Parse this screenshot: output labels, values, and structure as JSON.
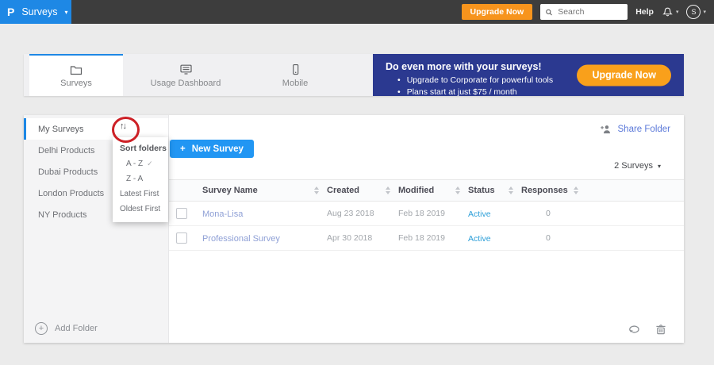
{
  "topbar": {
    "logo_glyph": "P",
    "product_menu_label": "Surveys",
    "upgrade_label": "Upgrade Now",
    "search_placeholder": "Search",
    "help_label": "Help",
    "avatar_initial": "S"
  },
  "tabs": [
    {
      "label": "Surveys",
      "active": true
    },
    {
      "label": "Usage Dashboard",
      "active": false
    },
    {
      "label": "Mobile",
      "active": false
    }
  ],
  "banner": {
    "title": "Do even more with your surveys!",
    "bullets": [
      "Upgrade to Corporate for powerful tools",
      "Plans start at just $75 / month"
    ],
    "cta_label": "Upgrade Now"
  },
  "sidebar": {
    "folders": [
      "My Surveys",
      "Delhi Products",
      "Dubai Products",
      "London Products",
      "NY Products"
    ],
    "active_folder": "My Surveys",
    "add_folder_label": "Add Folder"
  },
  "sort_menu": {
    "title": "Sort folders",
    "options": [
      "A - Z",
      "Z - A",
      "Latest First",
      "Oldest First"
    ],
    "selected_option": "A - Z",
    "check_glyph": "✓"
  },
  "toolbar": {
    "new_survey_label": "New Survey",
    "share_folder_label": "Share Folder",
    "survey_count_label": "2 Surveys"
  },
  "table": {
    "columns": [
      "Survey Name",
      "Created",
      "Modified",
      "Status",
      "Responses"
    ],
    "rows": [
      {
        "name": "Mona-Lisa",
        "created": "Aug 23 2018",
        "modified": "Feb 18 2019",
        "status": "Active",
        "responses": "0"
      },
      {
        "name": "Professional Survey",
        "created": "Apr 30 2018",
        "modified": "Feb 18 2019",
        "status": "Active",
        "responses": "0"
      }
    ]
  },
  "icons": {
    "sort_trigger_glyph": "↑↓",
    "caret_glyph": "▾",
    "bullet_glyph": "•",
    "plus_glyph": "+"
  },
  "colors": {
    "brand_blue": "#1e88e5",
    "button_blue": "#2196f3",
    "banner_navy": "#2b3990",
    "topbar_orange": "#f7941d",
    "banner_cta_orange": "#f9a01b",
    "annotation_red": "#cd2026",
    "status_active_blue": "#2d9fd8",
    "survey_link_blue": "#8fa0d6",
    "share_link_blue": "#5b79d9",
    "topbar_gray": "#3d3d3d"
  }
}
